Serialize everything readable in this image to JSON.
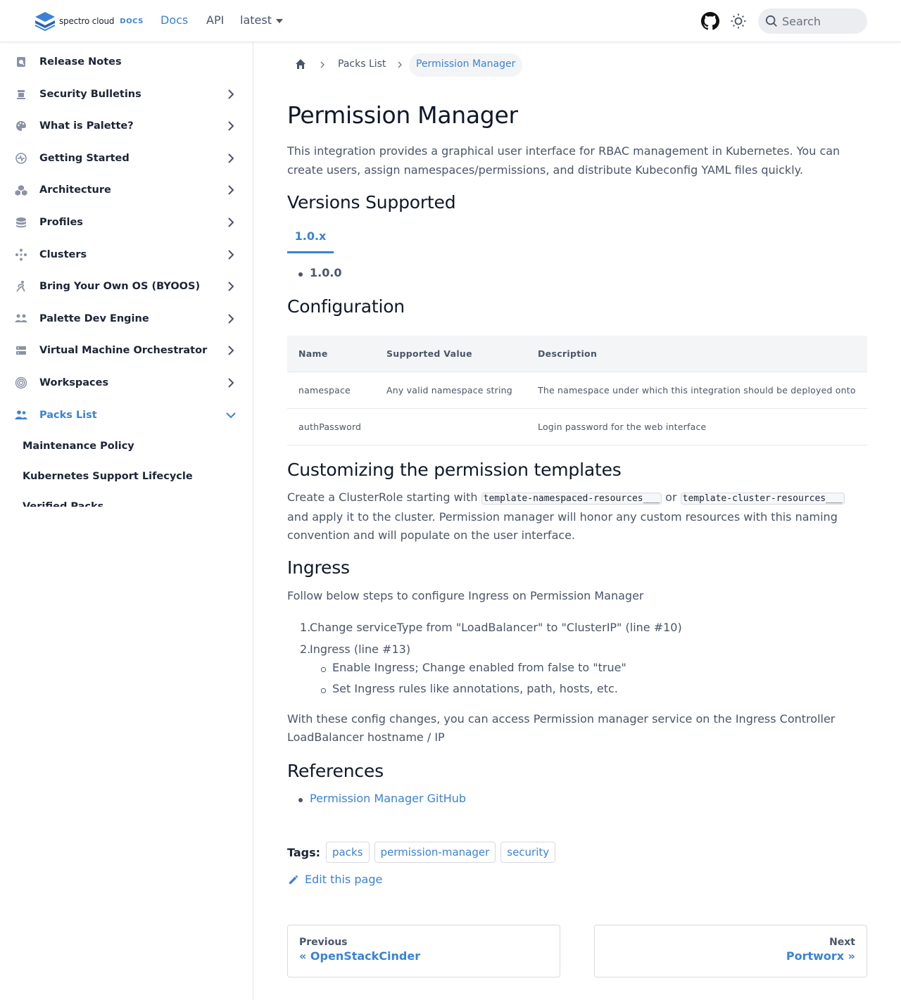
{
  "navbar": {
    "logo_text": "spectro cloud",
    "logo_docs": "DOCS",
    "links": {
      "docs": "Docs",
      "api": "API",
      "version": "latest"
    },
    "search_placeholder": "Search",
    "icons": {
      "github": "github-icon",
      "theme": "sun-icon",
      "search": "search-icon"
    },
    "accent_color": "#3b82d6"
  },
  "sidebar": {
    "items": [
      {
        "label": "Release Notes",
        "icon": "release-notes-icon",
        "has_children": false
      },
      {
        "label": "Security Bulletins",
        "icon": "security-bulletins-icon",
        "has_children": true
      },
      {
        "label": "What is Palette?",
        "icon": "palette-icon",
        "has_children": true
      },
      {
        "label": "Getting Started",
        "icon": "getting-started-icon",
        "has_children": true
      },
      {
        "label": "Architecture",
        "icon": "architecture-icon",
        "has_children": true
      },
      {
        "label": "Profiles",
        "icon": "profiles-icon",
        "has_children": true
      },
      {
        "label": "Clusters",
        "icon": "clusters-icon",
        "has_children": true
      },
      {
        "label": "Bring Your Own OS (BYOOS)",
        "icon": "byoos-icon",
        "has_children": true
      },
      {
        "label": "Palette Dev Engine",
        "icon": "dev-engine-icon",
        "has_children": true
      },
      {
        "label": "Virtual Machine Orchestrator",
        "icon": "vm-orchestrator-icon",
        "has_children": true
      },
      {
        "label": "Workspaces",
        "icon": "workspaces-icon",
        "has_children": true
      },
      {
        "label": "Packs List",
        "icon": "packs-list-icon",
        "has_children": true,
        "expanded": true,
        "active": true
      }
    ],
    "sub_items": [
      "Maintenance Policy",
      "Kubernetes Support Lifecycle",
      "Verified Packs"
    ]
  },
  "breadcrumb": {
    "home_icon": "home-icon",
    "items": [
      "Packs List",
      "Permission Manager"
    ]
  },
  "page": {
    "title": "Permission Manager",
    "intro": "This integration provides a graphical user interface for RBAC management in Kubernetes. You can create users, assign namespaces/permissions, and distribute Kubeconfig YAML files quickly.",
    "versions_heading": "Versions Supported",
    "version_tab": "1.0.x",
    "version_items": [
      "1.0.0"
    ],
    "config_heading": "Configuration",
    "config_table": {
      "headers": [
        "Name",
        "Supported Value",
        "Description"
      ],
      "rows": [
        [
          "namespace",
          "Any valid namespace string",
          "The namespace under which this integration should be deployed onto"
        ],
        [
          "authPassword",
          "",
          "Login password for the web interface"
        ]
      ]
    },
    "customizing_heading": "Customizing the permission templates",
    "customizing": {
      "text1": "Create a ClusterRole starting with ",
      "code1": "template-namespaced-resources___",
      "text2": " or ",
      "code2": "template-cluster-resources___",
      "text3": "and apply it to the cluster. Permission manager will honor any custom resources with this naming",
      "text4": "convention and will populate on the user interface."
    },
    "ingress_heading": "Ingress",
    "ingress_intro": "Follow below steps to configure Ingress on Permission Manager",
    "ingress_steps": [
      {
        "num": "1.",
        "text": "Change serviceType from \"LoadBalancer\" to \"ClusterIP\" (line #10)"
      },
      {
        "num": "2.",
        "text": "Ingress (line #13)"
      }
    ],
    "ingress_substeps": [
      "Enable Ingress; Change enabled from false to \"true\"",
      "Set Ingress rules like annotations, path, hosts, etc."
    ],
    "ingress_outro_1": "With these config changes, you can access Permission manager service on the Ingress Controller",
    "ingress_outro_2": "LoadBalancer hostname / IP",
    "references_heading": "References",
    "references": [
      "Permission Manager GitHub"
    ],
    "tags_label": "Tags:",
    "tags": [
      "packs",
      "permission-manager",
      "security"
    ],
    "edit_label": "Edit this page",
    "pager": {
      "prev_sub": "Previous",
      "prev_title": "« OpenStackCinder",
      "next_sub": "Next",
      "next_title": "Portworx »"
    }
  }
}
